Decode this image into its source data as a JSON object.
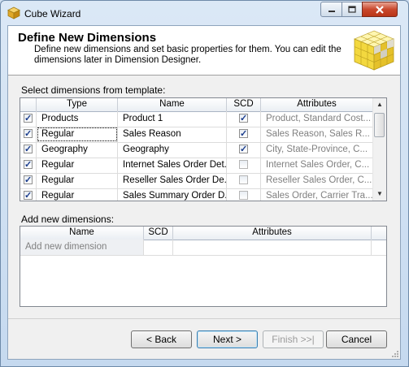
{
  "window": {
    "title": "Cube Wizard"
  },
  "header": {
    "title": "Define New Dimensions",
    "description": "Define new dimensions and set basic properties for them. You can edit the dimensions later in Dimension Designer."
  },
  "template_section": {
    "label": "Select dimensions from template:",
    "columns": [
      "Type",
      "Name",
      "SCD",
      "Attributes"
    ],
    "rows": [
      {
        "checked": true,
        "type": "Products",
        "name": "Product 1",
        "scd": true,
        "scd_enabled": true,
        "attributes": "Product,  Standard Cost..."
      },
      {
        "checked": true,
        "type": "Regular",
        "name": "Sales Reason",
        "scd": true,
        "scd_enabled": true,
        "attributes": "Sales Reason,  Sales R..."
      },
      {
        "checked": true,
        "type": "Geography",
        "name": "Geography",
        "scd": true,
        "scd_enabled": true,
        "attributes": "City,  State-Province,  C..."
      },
      {
        "checked": true,
        "type": "Regular",
        "name": "Internet Sales Order Det...",
        "scd": false,
        "scd_enabled": false,
        "attributes": "Internet Sales Order,  C..."
      },
      {
        "checked": true,
        "type": "Regular",
        "name": "Reseller Sales Order De...",
        "scd": false,
        "scd_enabled": false,
        "attributes": "Reseller Sales Order,  C..."
      },
      {
        "checked": true,
        "type": "Regular",
        "name": "Sales Summary Order D...",
        "scd": false,
        "scd_enabled": false,
        "attributes": "Sales Order,  Carrier Tra..."
      }
    ]
  },
  "new_section": {
    "label": "Add new dimensions:",
    "columns": [
      "Name",
      "SCD",
      "Attributes"
    ],
    "placeholder_row": "Add new dimension"
  },
  "buttons": {
    "back": "< Back",
    "next": "Next >",
    "finish": "Finish >>|",
    "cancel": "Cancel"
  },
  "colors": {
    "accent": "#3c7fb1",
    "header_bg": "#ffffff",
    "dialog_bg": "#f0f0f0"
  },
  "icons": [
    "cube-icon",
    "minimize-icon",
    "maximize-icon",
    "close-icon",
    "cube-grid-graphic",
    "scroll-up-icon",
    "scroll-down-icon",
    "resize-grip-icon"
  ]
}
